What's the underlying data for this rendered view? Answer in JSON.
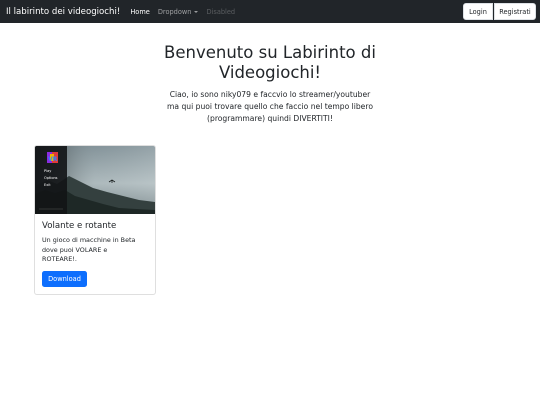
{
  "navbar": {
    "brand": "Il labirinto dei videogiochi!",
    "links": [
      {
        "label": "Home"
      },
      {
        "label": "Dropdown"
      },
      {
        "label": "Disabled"
      }
    ],
    "login_label": "Login",
    "register_label": "Registrati"
  },
  "hero": {
    "title_line1": "Benvenuto su Labirinto di",
    "title_line2": "Videogiochi!",
    "text_line1": "Ciao, io sono niky079 e faccvio lo streamer/youtuber",
    "text_line2": "ma qui puoi trovare quello che faccio nel tempo libero",
    "text_line3": "(programmare) quindi DIVERTITI!"
  },
  "card": {
    "image_logo": "VR",
    "image_menu": [
      "Play",
      "Options",
      "Exit"
    ],
    "title": "Volante e rotante",
    "text_line1": "Un gioco di macchine in Beta",
    "text_line2": "dove puoi VOLARE e",
    "text_line3": "ROTEARE!.",
    "button_label": "Download"
  },
  "colors": {
    "navbar_bg": "#212529",
    "primary": "#0d6efd"
  }
}
